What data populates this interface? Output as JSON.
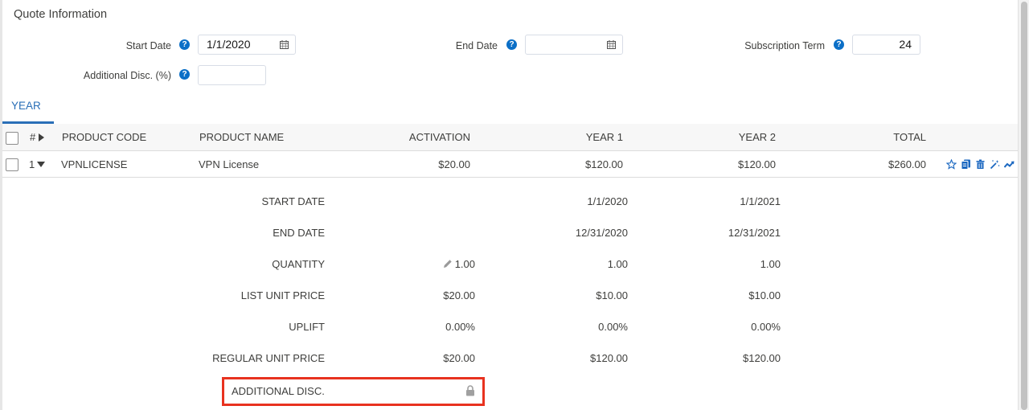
{
  "section": {
    "title": "Quote Information"
  },
  "fields": {
    "start_date": {
      "label": "Start Date",
      "value": "1/1/2020"
    },
    "end_date": {
      "label": "End Date",
      "value": ""
    },
    "subscription_term": {
      "label": "Subscription Term",
      "value": "24"
    },
    "additional_disc": {
      "label": "Additional Disc. (%)",
      "value": ""
    }
  },
  "tabs": [
    {
      "label": "YEAR",
      "active": true
    }
  ],
  "table": {
    "headers": {
      "number": "#",
      "product_code": "PRODUCT CODE",
      "product_name": "PRODUCT NAME",
      "activation": "ACTIVATION",
      "year1": "YEAR 1",
      "year2": "YEAR 2",
      "total": "TOTAL"
    },
    "rows": [
      {
        "number": "1",
        "product_code": "VPNLICENSE",
        "product_name": "VPN License",
        "activation": "$20.00",
        "year1": "$120.00",
        "year2": "$120.00",
        "total": "$260.00",
        "actions": [
          "star-icon",
          "clone-icon",
          "trash-icon",
          "magic-wand-icon",
          "trend-icon"
        ]
      }
    ]
  },
  "details": [
    {
      "label": "START DATE",
      "activation": "",
      "year1": "1/1/2020",
      "year2": "1/1/2021"
    },
    {
      "label": "END DATE",
      "activation": "",
      "year1": "12/31/2020",
      "year2": "12/31/2021"
    },
    {
      "label": "QUANTITY",
      "activation": "1.00",
      "year1": "1.00",
      "year2": "1.00",
      "editable": true
    },
    {
      "label": "LIST UNIT PRICE",
      "activation": "$20.00",
      "year1": "$10.00",
      "year2": "$10.00"
    },
    {
      "label": "UPLIFT",
      "activation": "0.00%",
      "year1": "0.00%",
      "year2": "0.00%"
    },
    {
      "label": "REGULAR UNIT PRICE",
      "activation": "$20.00",
      "year1": "$120.00",
      "year2": "$120.00"
    }
  ],
  "additional_disc_row": {
    "label": "ADDITIONAL DISC.",
    "locked": true
  },
  "colors": {
    "accent": "#2a6fb7",
    "help": "#0b6fc7",
    "highlight": "#e8321f"
  }
}
